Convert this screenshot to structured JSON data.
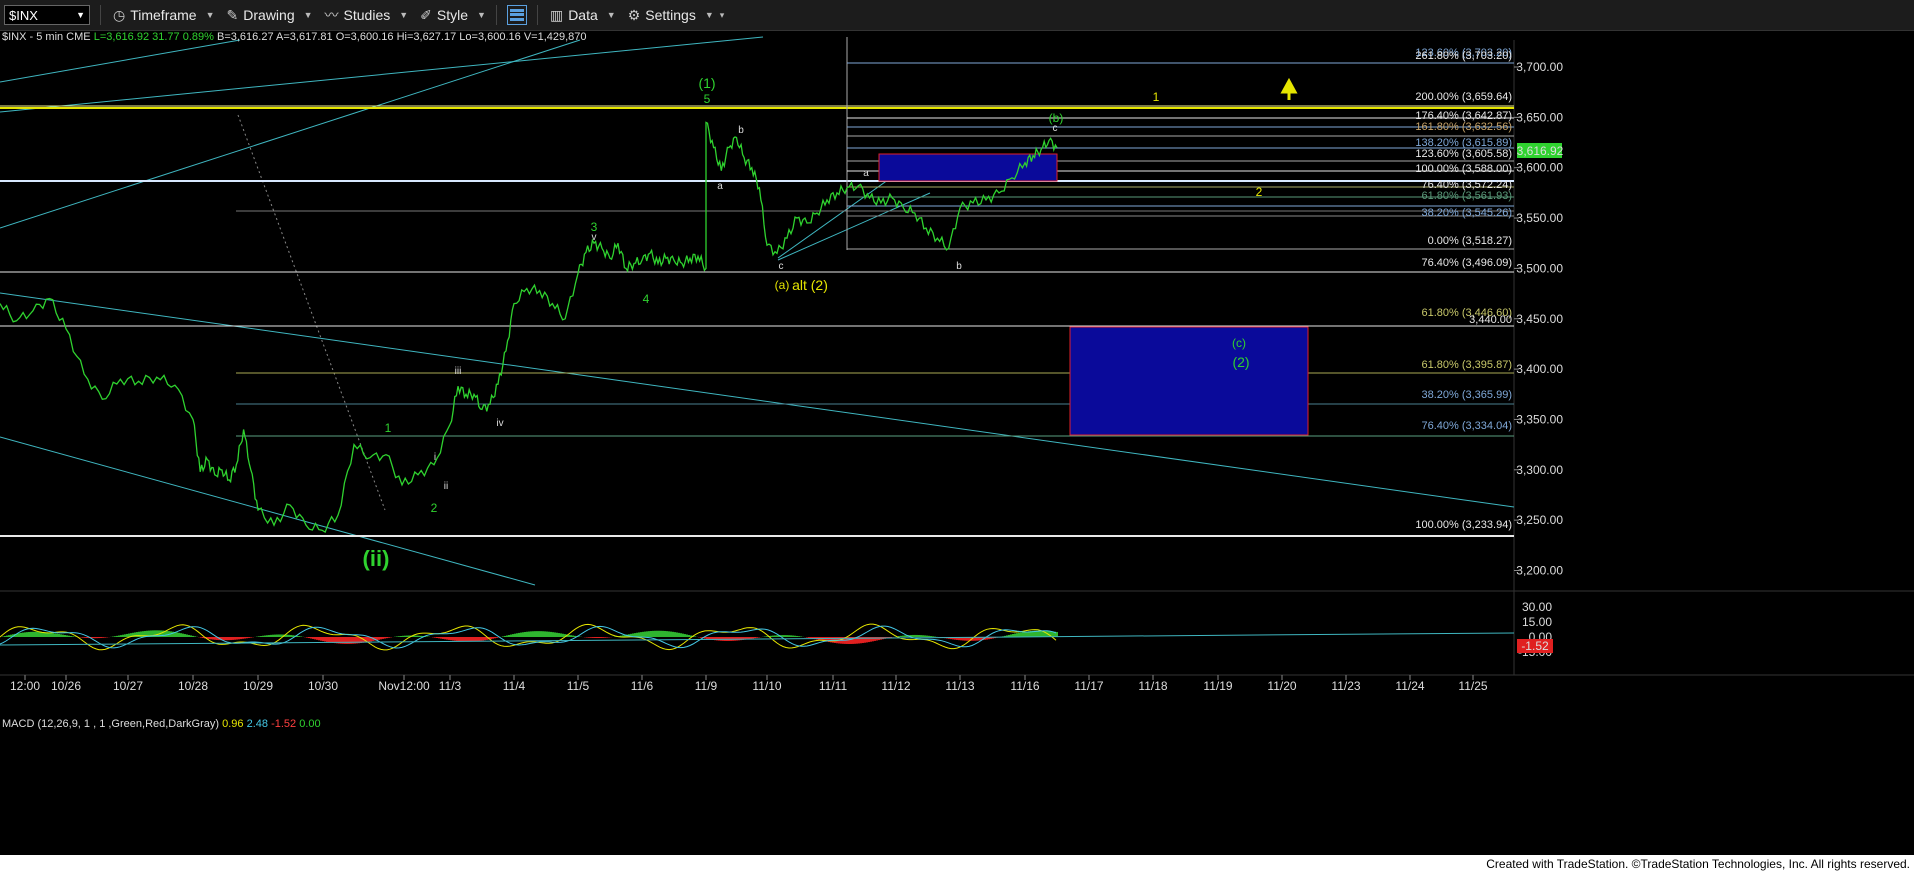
{
  "toolbar": {
    "symbol": "$INX",
    "timeframe": "Timeframe",
    "drawing": "Drawing",
    "studies": "Studies",
    "style": "Style",
    "data": "Data",
    "settings": "Settings"
  },
  "infobar": {
    "symbol": "$INX - 5 min  CME",
    "last": "L=3,616.92",
    "change": "31.77",
    "pct": "0.89%",
    "bid": "B=3,616.27",
    "ask": "A=3,617.81",
    "open": "O=3,600.16",
    "high": "Hi=3,627.17",
    "low": "Lo=3,600.16",
    "volume": "V=1,429,870"
  },
  "macd": {
    "label": "MACD (12,26,9, 1 , 1 ,Green,Red,DarkGray)",
    "v1": "0.96",
    "v2": "2.48",
    "v3": "-1.52",
    "v4": "0.00"
  },
  "footer": "Created with TradeStation. ©TradeStation Technologies, Inc. All rights reserved.",
  "chart_data": {
    "type": "line",
    "title": "$INX - 5 min",
    "ylim": [
      3175,
      3725
    ],
    "y_ticks": [
      "3,700.00",
      "3,650.00",
      "3,600.00",
      "3,550.00",
      "3,500.00",
      "3,450.00",
      "3,400.00",
      "3,350.00",
      "3,300.00",
      "3,250.00",
      "3,200.00"
    ],
    "x_ticks": [
      "12:00",
      "10/26",
      "10/27",
      "10/28",
      "10/29",
      "10/30",
      "Nov12:00",
      "11/3",
      "11/4",
      "11/5",
      "11/6",
      "11/9",
      "11/10",
      "11/11",
      "11/12",
      "11/13",
      "11/16",
      "11/17",
      "11/18",
      "11/19",
      "11/20",
      "11/23",
      "11/24",
      "11/25"
    ],
    "last_price": "3,616.92",
    "price_path": [
      [
        0,
        3465
      ],
      [
        1,
        3448
      ],
      [
        2,
        3458
      ],
      [
        3,
        3470
      ],
      [
        4,
        3440
      ],
      [
        5,
        3395
      ],
      [
        6,
        3370
      ],
      [
        7,
        3390
      ],
      [
        8,
        3388
      ],
      [
        9,
        3392
      ],
      [
        10,
        3384
      ],
      [
        11,
        3350
      ],
      [
        12,
        3298
      ],
      [
        13,
        3310
      ],
      [
        14,
        3295
      ],
      [
        15,
        3300
      ],
      [
        16,
        3290
      ],
      [
        17,
        3305
      ],
      [
        18,
        3340
      ],
      [
        19,
        3300
      ],
      [
        20,
        3260
      ],
      [
        21,
        3245
      ],
      [
        22,
        3265
      ],
      [
        23,
        3245
      ],
      [
        24,
        3240
      ],
      [
        25,
        3255
      ],
      [
        26,
        3325
      ],
      [
        27,
        3312
      ],
      [
        28,
        3315
      ],
      [
        29,
        3285
      ],
      [
        30,
        3295
      ],
      [
        31,
        3305
      ],
      [
        32,
        3345
      ],
      [
        33,
        3383
      ],
      [
        34,
        3375
      ],
      [
        35,
        3375
      ],
      [
        36,
        3360
      ],
      [
        37,
        3365
      ],
      [
        38,
        3385
      ],
      [
        39,
        3418
      ],
      [
        40,
        3465
      ],
      [
        41,
        3480
      ],
      [
        42,
        3478
      ],
      [
        43,
        3465
      ],
      [
        44,
        3450
      ],
      [
        45,
        3495
      ],
      [
        46,
        3516
      ],
      [
        47,
        3525
      ],
      [
        48,
        3520
      ],
      [
        49,
        3510
      ],
      [
        50,
        3525
      ],
      [
        51,
        3500
      ],
      [
        52,
        3505
      ],
      [
        53,
        3508
      ],
      [
        54,
        3515
      ],
      [
        55,
        3505
      ],
      [
        56,
        3510
      ],
      [
        57,
        3508
      ],
      [
        58,
        3505
      ],
      [
        59,
        3510
      ],
      [
        60,
        3512
      ],
      [
        61,
        3500
      ],
      [
        62,
        3645
      ],
      [
        63,
        3620
      ],
      [
        64,
        3597
      ],
      [
        65,
        3620
      ],
      [
        66,
        3630
      ],
      [
        67,
        3610
      ],
      [
        68,
        3600
      ],
      [
        69,
        3580
      ],
      [
        70,
        3523
      ],
      [
        71,
        3515
      ],
      [
        72,
        3530
      ],
      [
        73,
        3550
      ],
      [
        74,
        3545
      ],
      [
        75,
        3555
      ],
      [
        76,
        3568
      ],
      [
        77,
        3575
      ],
      [
        78,
        3580
      ],
      [
        79,
        3582
      ],
      [
        80,
        3570
      ],
      [
        81,
        3565
      ],
      [
        82,
        3570
      ],
      [
        83,
        3560
      ],
      [
        84,
        3555
      ],
      [
        85,
        3540
      ],
      [
        86,
        3530
      ],
      [
        87,
        3520
      ],
      [
        88,
        3560
      ],
      [
        89,
        3565
      ],
      [
        90,
        3568
      ],
      [
        91,
        3575
      ],
      [
        92,
        3590
      ],
      [
        93,
        3605
      ],
      [
        94,
        3612
      ],
      [
        95,
        3618
      ],
      [
        96,
        3627
      ],
      [
        97,
        3620
      ]
    ],
    "fib_levels": [
      {
        "label": "123.60% (3,703.20)",
        "value": 3703.2
      },
      {
        "label": "261.80% (3,703.20)",
        "value": 3703.2
      },
      {
        "label": "200.00% (3,659.64)",
        "value": 3659.6
      },
      {
        "label": "176.40% (3,642.87)",
        "value": 3642.87
      },
      {
        "label": "161.80% (3,632.56)",
        "value": 3632.56
      },
      {
        "label": "138.20% (3,615.89)",
        "value": 3615.89
      },
      {
        "label": "123.60% (3,605.58)",
        "value": 3605.58
      },
      {
        "label": "100.00% (3,588.00)",
        "value": 3588.0
      },
      {
        "label": "76.40% (3,572.24)",
        "value": 3572.24
      },
      {
        "label": "61.80% (3,561.93)",
        "value": 3561.93
      },
      {
        "label": "38.20% (3,545.26)",
        "value": 3545.26
      },
      {
        "label": "0.00% (3,518.27)",
        "value": 3518.27
      },
      {
        "label": "76.40% (3,496.09)",
        "value": 3496.09
      },
      {
        "label": "61.80% (3,446.60)",
        "value": 3446.6
      },
      {
        "label": "3,440.00",
        "value": 3440.0
      },
      {
        "label": "61.80% (3,395.87)",
        "value": 3395.87
      },
      {
        "label": "38.20% (3,365.99)",
        "value": 3365.99
      },
      {
        "label": "76.40% (3,334.04)",
        "value": 3334.04
      },
      {
        "label": "100.00% (3,233.94)",
        "value": 3233.94
      }
    ],
    "wave_labels": [
      {
        "text": "(1)",
        "color": "#2fd22f"
      },
      {
        "text": "5",
        "color": "#2fd22f"
      },
      {
        "text": "3",
        "color": "#2fd22f"
      },
      {
        "text": "v",
        "color": "#dddddd"
      },
      {
        "text": "4",
        "color": "#2fd22f"
      },
      {
        "text": "iii",
        "color": "#dddddd"
      },
      {
        "text": "iv",
        "color": "#dddddd"
      },
      {
        "text": "1",
        "color": "#2fd22f"
      },
      {
        "text": "i",
        "color": "#dddddd"
      },
      {
        "text": "ii",
        "color": "#dddddd"
      },
      {
        "text": "2",
        "color": "#2fd22f"
      },
      {
        "text": "(ii)",
        "color": "#2fd22f"
      },
      {
        "text": "a",
        "color": "#dddddd"
      },
      {
        "text": "b",
        "color": "#dddddd"
      },
      {
        "text": "c",
        "color": "#dddddd"
      },
      {
        "text": "(a)",
        "color": "#e6e600"
      },
      {
        "text": "alt (2)",
        "color": "#e6e600"
      },
      {
        "text": "a",
        "color": "#dddddd"
      },
      {
        "text": "b",
        "color": "#dddddd"
      },
      {
        "text": "(b)",
        "color": "#2fd22f"
      },
      {
        "text": "c",
        "color": "#dddddd"
      },
      {
        "text": "1",
        "color": "#e6e600"
      },
      {
        "text": "2",
        "color": "#e6e600"
      },
      {
        "text": "(c)",
        "color": "#2fd22f"
      },
      {
        "text": "(2)",
        "color": "#2fd22f"
      }
    ],
    "macd_ticks": [
      "30.00",
      "15.00",
      "0.00",
      "-15.00"
    ],
    "macd_last": "-1.52",
    "colors": {
      "price": "#2fd22f",
      "fib": "#5a9cc8",
      "boxFill": "#0a0a9a",
      "boxBorder": "#e0202a",
      "yellow": "#e6e600",
      "teal": "#3fb6c0",
      "white": "#e8e8e8"
    }
  }
}
